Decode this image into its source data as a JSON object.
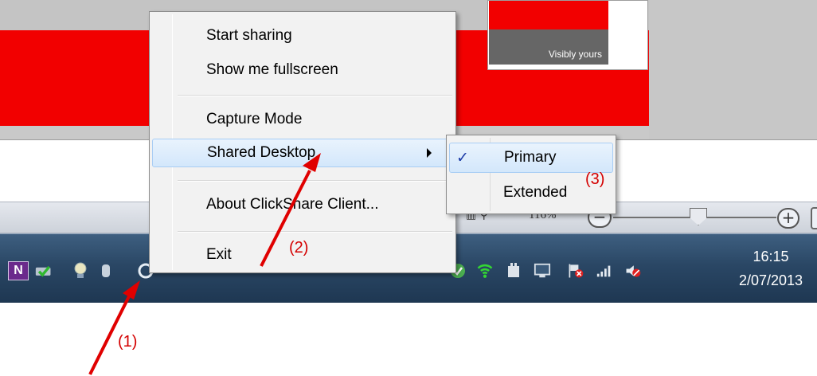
{
  "background": {
    "logo_text": "Visibly yours",
    "zoom_value": "116%",
    "zoom_minus": "−",
    "zoom_plus": "+"
  },
  "context_menu": {
    "items": [
      {
        "label": "Start sharing"
      },
      {
        "label": "Show me fullscreen"
      },
      {
        "label": "Capture Mode"
      },
      {
        "label": "Shared Desktop"
      },
      {
        "label": "About ClickShare Client..."
      },
      {
        "label": "Exit"
      }
    ]
  },
  "submenu": {
    "items": [
      {
        "label": "Primary",
        "checked": true
      },
      {
        "label": "Extended",
        "checked": false
      }
    ],
    "check_glyph": "✓"
  },
  "taskbar": {
    "onenote_label": "N",
    "clock_time": "16:15",
    "clock_date": "2/07/2013"
  },
  "annotations": {
    "step1": "(1)",
    "step2": "(2)",
    "step3": "(3)",
    "color": "#e00000"
  },
  "colors": {
    "brand_red": "#f20000",
    "highlight": "#d3e7fb",
    "taskbar": "#2a4765"
  }
}
